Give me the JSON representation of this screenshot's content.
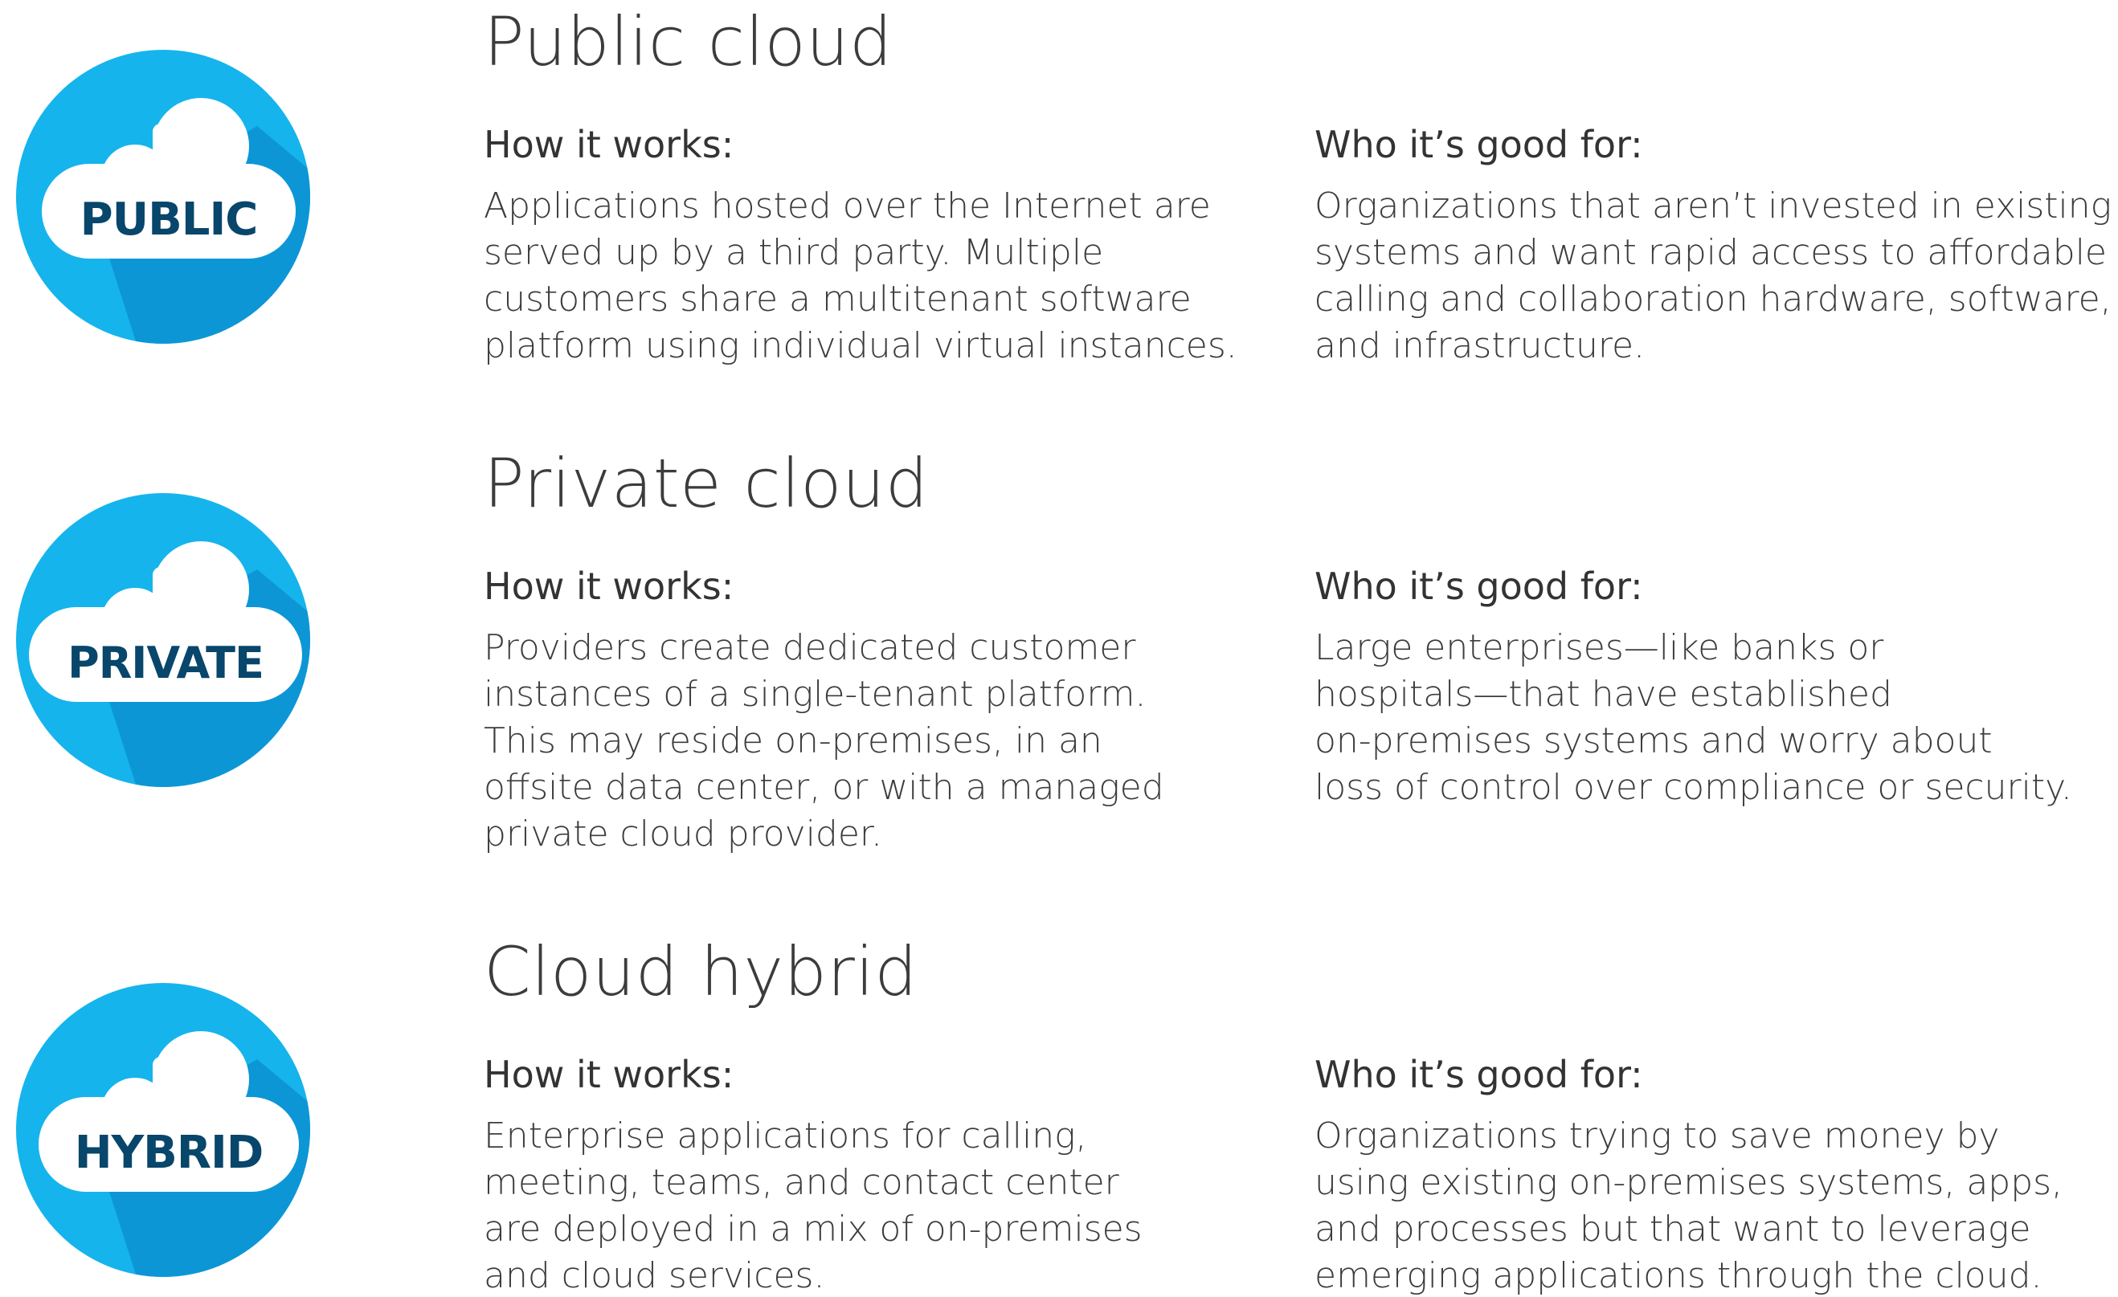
{
  "colors": {
    "circle_light": "#15b4ec",
    "circle_shadow": "#0d96d6",
    "cloud": "#ffffff",
    "badge_text": "#08466b"
  },
  "sections": [
    {
      "title": "Public cloud",
      "badge": {
        "icon": "cloud-icon",
        "label": "PUBLIC"
      },
      "how_heading": "How it works:",
      "how_lines": [
        "Applications hosted over the Internet are",
        "served up by a third party. Multiple",
        "customers share a multitenant software",
        "platform using individual virtual instances."
      ],
      "who_heading": "Who it’s good for:",
      "who_lines": [
        "Organizations that aren’t invested in existing",
        "systems and want rapid access to affordable",
        "calling and collaboration hardware, software,",
        "and infrastructure."
      ]
    },
    {
      "title": "Private cloud",
      "badge": {
        "icon": "cloud-icon",
        "label": "PRIVATE"
      },
      "how_heading": "How it works:",
      "how_lines": [
        "Providers create dedicated customer",
        "instances of a single-tenant platform.",
        "This may reside on-premises, in an",
        "offsite data center, or with a managed",
        "private cloud provider."
      ],
      "who_heading": "Who it’s good for:",
      "who_lines": [
        "Large enterprises—like banks or",
        "hospitals—that have established",
        "on-premises systems and worry about",
        "loss of control over compliance or security."
      ]
    },
    {
      "title": "Cloud hybrid",
      "badge": {
        "icon": "cloud-icon",
        "label": "HYBRID"
      },
      "how_heading": "How it works:",
      "how_lines": [
        "Enterprise applications for calling,",
        "meeting, teams, and contact center",
        "are deployed in a mix of on-premises",
        "and cloud services."
      ],
      "who_heading": "Who it’s good for:",
      "who_lines": [
        "Organizations trying to save money by",
        "using existing on-premises systems, apps,",
        "and processes but that want to leverage",
        "emerging applications through the cloud."
      ]
    }
  ]
}
